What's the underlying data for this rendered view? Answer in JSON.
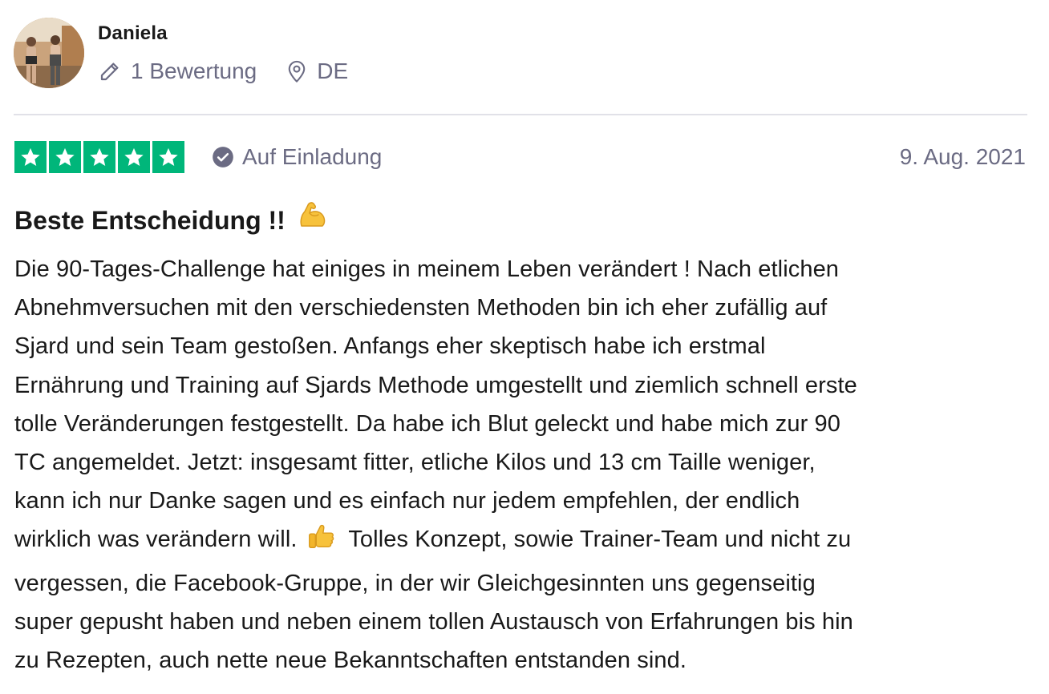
{
  "consumer": {
    "name": "Daniela",
    "reviews_count": "1 Bewertung",
    "country": "DE",
    "icons": {
      "reviews": "pencil-icon",
      "location": "location-pin-icon"
    }
  },
  "review": {
    "rating": 5,
    "rating_max": 5,
    "star_color": "#00b67a",
    "invited_label": "Auf Einladung",
    "invited_icon": "verified-check-icon",
    "date": "9. Aug. 2021",
    "title": "Beste Entscheidung !!",
    "title_emoji": "flexed-biceps-emoji",
    "body_lines": [
      "Die 90-Tages-Challenge hat einiges in meinem Leben verändert ! Nach etlichen",
      "Abnehmversuchen mit den verschiedensten Methoden bin ich eher zufällig auf",
      "Sjard und sein Team gestoßen. Anfangs eher skeptisch habe ich erstmal",
      "Ernährung und Training auf Sjards Methode umgestellt und ziemlich schnell erste",
      "tolle Veränderungen festgestellt. Da habe ich Blut geleckt und habe mich zur 90",
      "TC angemeldet. Jetzt: insgesamt fitter, etliche Kilos und 13 cm Taille weniger,",
      "kann ich nur Danke sagen und es einfach nur jedem empfehlen, der endlich"
    ],
    "body_line_8_before_emoji": "wirklich was verändern will.",
    "body_line_8_emoji": "thumbs-up-emoji",
    "body_line_8_after_emoji": "Tolles Konzept, sowie Trainer-Team und nicht zu",
    "body_lines_after": [
      "vergessen, die Facebook-Gruppe, in der wir Gleichgesinnten uns gegenseitig",
      "super gepusht haben und neben einem tollen Austausch von Erfahrungen bis hin",
      "zu Rezepten, auch nette neue Bekanntschaften entstanden sind."
    ]
  },
  "colors": {
    "text_primary": "#191919",
    "text_secondary": "#6b6b83",
    "divider": "#e1e1e8",
    "trustpilot_green": "#00b67a"
  }
}
